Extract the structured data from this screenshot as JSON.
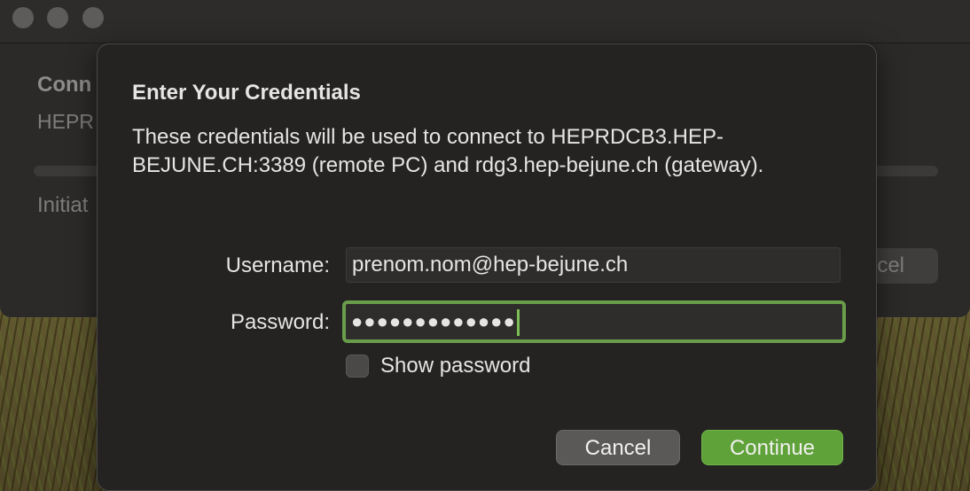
{
  "background_window": {
    "title": "Conn",
    "host": "HEPR",
    "status": "Initiat",
    "cancel_button": "cel"
  },
  "dialog": {
    "title": "Enter Your Credentials",
    "description": "These credentials will be used to connect to HEPRDCB3.HEP-BEJUNE.CH:3389 (remote PC) and rdg3.hep-bejune.ch (gateway).",
    "username_label": "Username:",
    "username_value": "prenom.nom@hep-bejune.ch",
    "password_label": "Password:",
    "password_value": "●●●●●●●●●●●●●",
    "show_password_label": "Show password",
    "show_password_checked": false,
    "cancel_label": "Cancel",
    "continue_label": "Continue"
  },
  "colors": {
    "accent": "#5fa23a",
    "focus_ring": "#6a9d4a",
    "sheet_background": "#242321"
  }
}
